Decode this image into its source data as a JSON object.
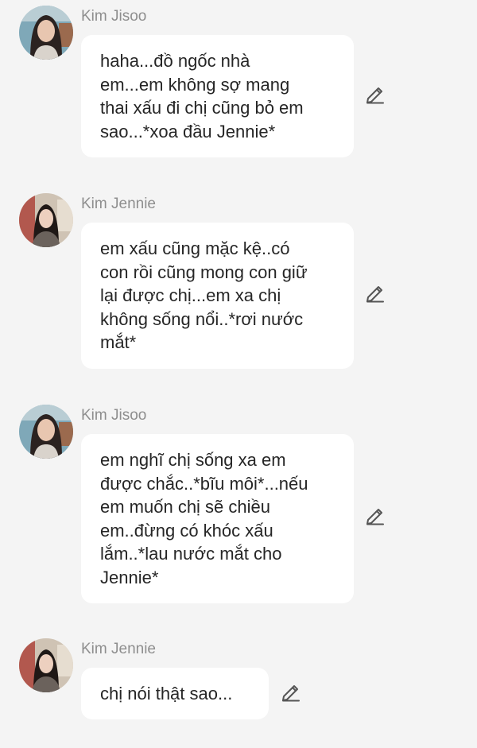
{
  "messages": [
    {
      "sender": "Kim Jisoo",
      "avatar": "jisoo-avatar",
      "lines": [
        "haha...đồ ngốc nhà",
        "em...em không sợ mang",
        "thai xấu đi chị cũng bỏ em",
        "sao...*xoa đầu Jennie*"
      ],
      "action_icon": "pencil-edit-icon"
    },
    {
      "sender": "Kim Jennie",
      "avatar": "jennie-avatar",
      "lines": [
        "em xấu cũng mặc kệ..có",
        "con rồi cũng mong con giữ",
        "lại được chị...em xa chị",
        "không sống nổi..*rơi nước",
        "mắt*"
      ],
      "action_icon": "pencil-edit-icon"
    },
    {
      "sender": "Kim Jisoo",
      "avatar": "jisoo-avatar",
      "lines": [
        "em nghĩ chị sống xa em",
        "được chắc..*bĩu môi*...nếu",
        "em muốn chị sẽ chiều",
        "em..đừng có khóc xấu",
        "lắm..*lau nước mắt cho",
        "Jennie*"
      ],
      "action_icon": "pencil-edit-icon"
    },
    {
      "sender": "Kim Jennie",
      "avatar": "jennie-avatar",
      "lines": [
        "chị nói thật sao..."
      ],
      "action_icon": "pencil-edit-icon"
    }
  ],
  "colors": {
    "background": "#f4f4f4",
    "bubble": "#ffffff",
    "sender_text": "#8e8e8e",
    "message_text": "#262626",
    "icon": "#555555"
  }
}
